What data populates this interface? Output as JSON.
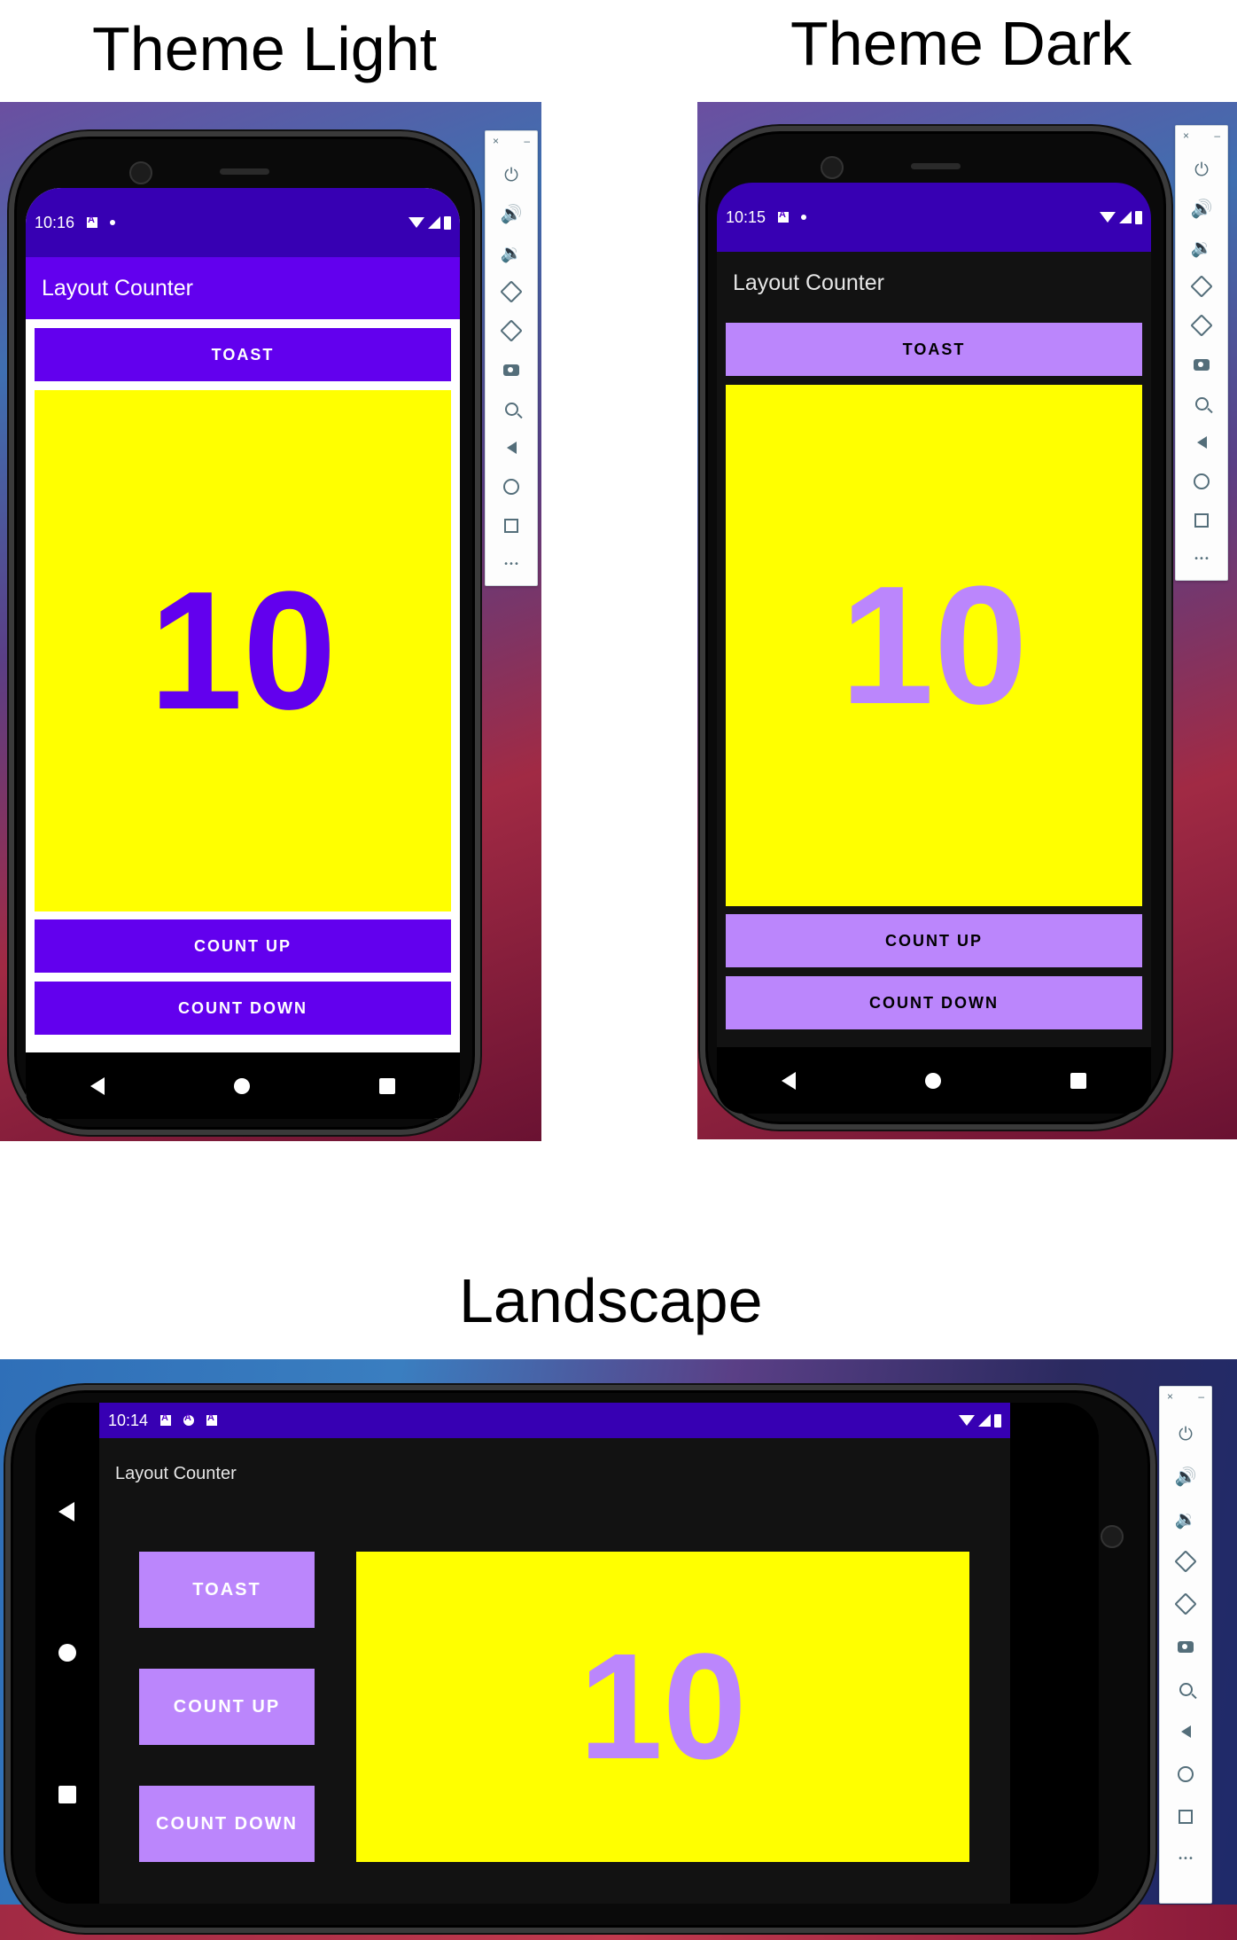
{
  "headings": {
    "light": "Theme Light",
    "dark": "Theme Dark",
    "landscape": "Landscape"
  },
  "colors": {
    "purple_primary": "#6200ee",
    "purple_dark_status": "#3700b3",
    "purple_light": "#bb86fc",
    "yellow": "#ffff00",
    "dark_bg": "#121212",
    "white": "#ffffff",
    "black": "#000000"
  },
  "light_phone": {
    "status_time": "10:16",
    "app_title": "Layout Counter",
    "toast_label": "TOAST",
    "count_value": "10",
    "count_up_label": "COUNT UP",
    "count_down_label": "COUNT DOWN"
  },
  "dark_phone": {
    "status_time": "10:15",
    "app_title": "Layout Counter",
    "toast_label": "TOAST",
    "count_value": "10",
    "count_up_label": "COUNT UP",
    "count_down_label": "COUNT DOWN"
  },
  "landscape_phone": {
    "status_time": "10:14",
    "app_title": "Layout Counter",
    "toast_label": "TOAST",
    "count_value": "10",
    "count_up_label": "COUNT UP",
    "count_down_label": "COUNT DOWN"
  },
  "emulator_toolbar": {
    "close_glyph": "×",
    "minimize_glyph": "–",
    "more_glyph": "•••",
    "icons": [
      "power-icon",
      "volume-up-icon",
      "volume-down-icon",
      "rotate-left-icon",
      "rotate-right-icon",
      "camera-icon",
      "zoom-icon",
      "back-icon",
      "home-icon",
      "overview-icon",
      "more-icon"
    ]
  }
}
